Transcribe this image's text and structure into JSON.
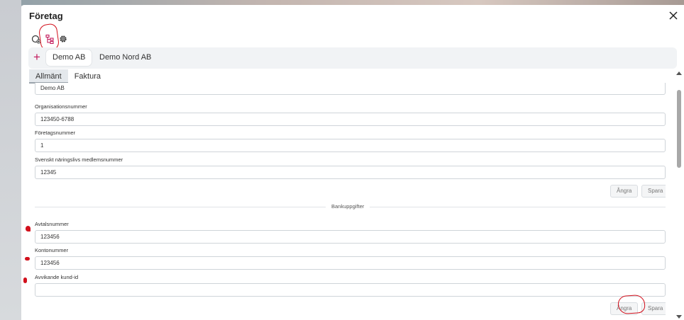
{
  "dialog": {
    "title": "Företag"
  },
  "toolbar": {
    "tools": [
      {
        "icon": "company-add-icon"
      },
      {
        "icon": "hierarchy-icon"
      },
      {
        "icon": "gear-icon"
      }
    ]
  },
  "companies": {
    "add_label": "+",
    "tabs": [
      {
        "label": "Demo AB",
        "active": true
      },
      {
        "label": "Demo Nord AB",
        "active": false
      }
    ]
  },
  "tabs": [
    {
      "label": "Allmänt",
      "active": true
    },
    {
      "label": "Faktura",
      "active": false
    }
  ],
  "general": {
    "name_value": "Demo AB",
    "org_label": "Organisationsnummer",
    "org_value": "123450-6788",
    "company_no_label": "Företagsnummer",
    "company_no_value": "1",
    "member_label": "Svenskt näringslivs medlemsnummer",
    "member_value": "12345",
    "undo_label": "Ångra",
    "save_label": "Spara"
  },
  "bank": {
    "section_label": "Bankuppgifter",
    "agreement_label": "Avtalsnummer",
    "agreement_value": "123456",
    "account_label": "Kontonummer",
    "account_value": "123456",
    "customer_id_label": "Avvikande kund-id",
    "customer_id_value": "",
    "undo_label": "Ångra",
    "save_label": "Spara"
  },
  "colors": {
    "accent": "#c2185b",
    "annotation": "#d2101c"
  }
}
